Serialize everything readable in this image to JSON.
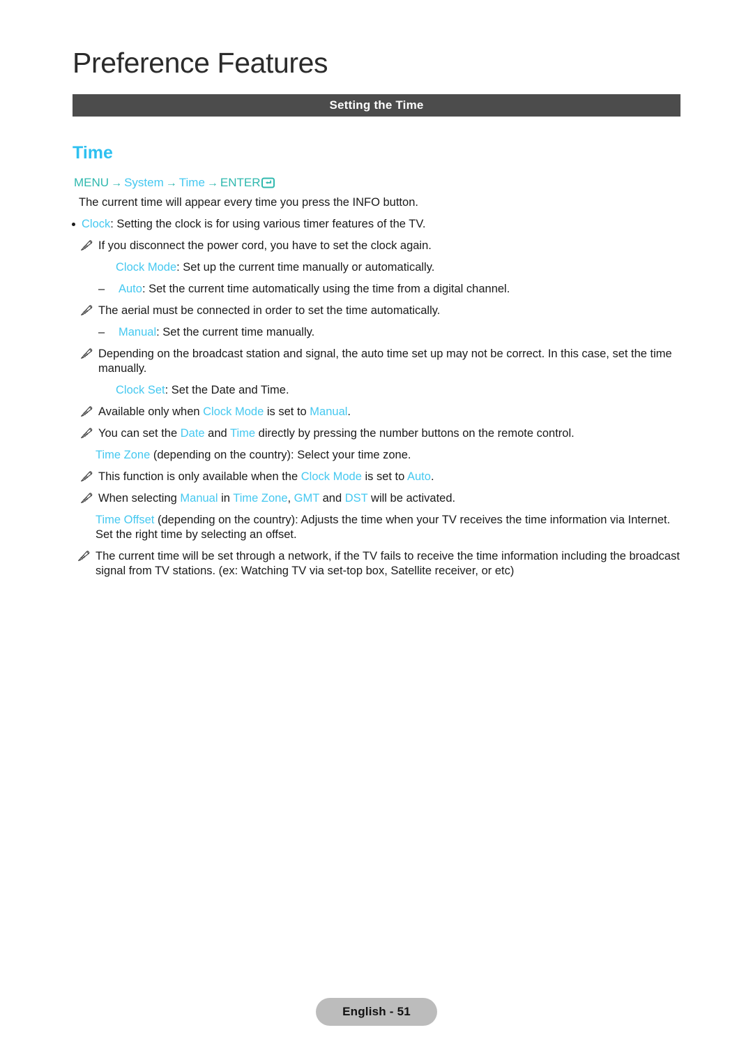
{
  "page": {
    "chapter_title": "Preference Features",
    "section_banner": "Setting the Time",
    "heading": "Time"
  },
  "menu_path": {
    "menu_label": "MENU",
    "arrow": "→",
    "system_label": "System",
    "time_label": "Time",
    "enter_label": "ENTER",
    "enter_icon": "enter-key-icon",
    "colors": {
      "key": "#2fb8ae",
      "value": "#45c8f0"
    }
  },
  "colors": {
    "accent_blue": "#45c8f0",
    "heading_blue": "#2ec0f0",
    "banner_bg": "#4c4c4c",
    "body_text": "#1a1a1a",
    "footer_pill_bg": "#bcbcbc"
  },
  "body": {
    "intro": "The current time will appear every time you press the INFO button.",
    "clock_term": "Clock",
    "clock_desc": ": Setting the clock is for using various timer features of the TV.",
    "note_power_cord": "If you disconnect the power cord, you have to set the clock again.",
    "clock_mode_term": "Clock Mode",
    "clock_mode_desc": ": Set up the current time manually or automatically.",
    "auto_term": "Auto",
    "auto_desc": ": Set the current time automatically using the time from a digital channel.",
    "note_aerial": "The aerial must be connected in order to set the time automatically.",
    "manual_term": "Manual",
    "manual_desc": ": Set the current time manually.",
    "note_depending": "Depending on the broadcast station and signal, the auto time set up may not be correct. In this case, set the time manually.",
    "clock_set_term": "Clock Set",
    "clock_set_desc": ": Set the Date and Time.",
    "note_available_pre": "Available only when ",
    "note_available_mid": " is set to ",
    "note_available_end": ".",
    "note_available_term1": "Clock Mode",
    "note_available_term2": "Manual",
    "note_numbers_pre": "You can set the ",
    "note_numbers_term1": "Date",
    "note_numbers_mid": " and ",
    "note_numbers_term2": "Time",
    "note_numbers_end": " directly by pressing the number buttons on the remote control.",
    "time_zone_term": "Time Zone",
    "time_zone_desc": " (depending on the country): Select your time zone.",
    "note_function_pre": "This function is only available when the ",
    "note_function_term1": "Clock Mode",
    "note_function_mid": " is set to ",
    "note_function_term2": "Auto",
    "note_function_end": ".",
    "note_selecting_pre": "When selecting ",
    "note_selecting_term1": "Manual",
    "note_selecting_mid1": " in ",
    "note_selecting_term2": "Time Zone",
    "note_selecting_mid2": ", ",
    "note_selecting_term3": "GMT",
    "note_selecting_mid3": " and ",
    "note_selecting_term4": "DST",
    "note_selecting_end": " will be activated.",
    "time_offset_term": "Time Offset",
    "time_offset_desc": " (depending on the country): Adjusts the time when your TV receives the time information via Internet. Set the right time by selecting an offset.",
    "note_network": "The current time will be set through a network, if the TV fails to receive the time information including the broadcast signal from TV stations. (ex: Watching TV via set-top box, Satellite receiver, or etc)"
  },
  "footer": {
    "page_label": "English - 51"
  }
}
